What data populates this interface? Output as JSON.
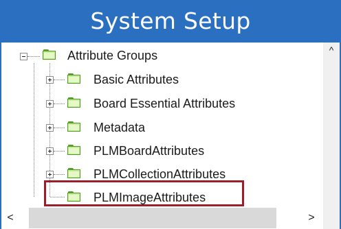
{
  "header": {
    "title": "System Setup"
  },
  "tree": {
    "root": {
      "label": "Attribute Groups",
      "expanded": true,
      "icon": "folder-icon"
    },
    "children": [
      {
        "label": "Basic Attributes",
        "expandable": true,
        "icon": "folder-icon"
      },
      {
        "label": "Board Essential Attributes",
        "expandable": true,
        "icon": "folder-icon"
      },
      {
        "label": "Metadata",
        "expandable": true,
        "icon": "folder-icon"
      },
      {
        "label": "PLMBoardAttributes",
        "expandable": true,
        "icon": "folder-icon"
      },
      {
        "label": "PLMCollectionAttributes",
        "expandable": true,
        "icon": "folder-icon"
      },
      {
        "label": "PLMImageAttributes",
        "expandable": false,
        "icon": "folder-icon",
        "highlighted": true
      }
    ]
  },
  "scrollbars": {
    "up_arrow": "^",
    "left_arrow": "<",
    "right_arrow": ">"
  },
  "colors": {
    "header_bg": "#2a6fc0",
    "highlight_border": "#9b1f2b",
    "folder_green": "#c7ec9a"
  }
}
